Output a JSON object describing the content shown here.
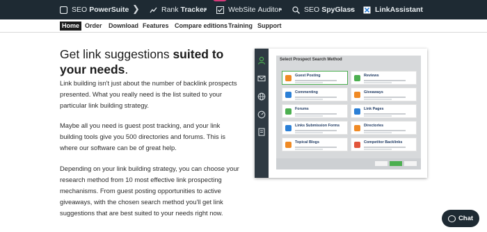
{
  "products": {
    "seo_powersuite": {
      "prefix": "SEO",
      "name": "PowerSuite"
    },
    "rank_tracker": {
      "prefix": "Rank",
      "name": "Tracker"
    },
    "website_auditor": {
      "prefix": "WebSite",
      "name": "Auditor"
    },
    "seo_spyglass": {
      "prefix": "SEO",
      "name": "SpyGlass"
    },
    "link_assistant": {
      "prefix": "",
      "name": "LinkAssistant"
    }
  },
  "nav": {
    "home": "Home",
    "order": "Order",
    "download": "Download",
    "features": "Features",
    "compare": "Compare editions",
    "training": "Training",
    "support": "Support"
  },
  "main": {
    "headline_normal": "Get link suggestions ",
    "headline_bold": "suited to your needs",
    "headline_end": ".",
    "para1": "Link building isn't just about the number of backlink prospects presented. What you really need is the list suited to your particular link building strategy.",
    "para2": "Maybe all you need is guest post tracking, and your link building tools give you 500 directories and forums. This is where our software can be of great help.",
    "para3": "Depending on your link building strategy, you can choose your research method from 10 most effective link prospecting mechanisms. From guest posting opportunities to active giveaways, with the chosen search method you'll get link suggestions that are best suited to your needs right now."
  },
  "mockup": {
    "title": "Select Prospect Search Method",
    "methods": [
      {
        "label": "Guest Posting",
        "color": "#f08a24",
        "icon": "guest-posting-icon"
      },
      {
        "label": "Reviews",
        "color": "#4caf50",
        "icon": "reviews-icon"
      },
      {
        "label": "Commenting",
        "color": "#2b7fd6",
        "icon": "commenting-icon"
      },
      {
        "label": "Giveaways",
        "color": "#f08a24",
        "icon": "giveaways-icon"
      },
      {
        "label": "Forums",
        "color": "#4caf50",
        "icon": "forums-icon"
      },
      {
        "label": "Link Pages",
        "color": "#2b7fd6",
        "icon": "link-pages-icon"
      },
      {
        "label": "Links Submission Forms",
        "color": "#2b7fd6",
        "icon": "submission-forms-icon"
      },
      {
        "label": "Directories",
        "color": "#f08a24",
        "icon": "directories-icon"
      },
      {
        "label": "Topical Blogs",
        "color": "#f08a24",
        "icon": "topical-blogs-icon"
      },
      {
        "label": "Competitor Backlinks",
        "color": "#e2553b",
        "icon": "competitor-backlinks-icon"
      }
    ]
  },
  "chat": {
    "label": "Chat"
  }
}
